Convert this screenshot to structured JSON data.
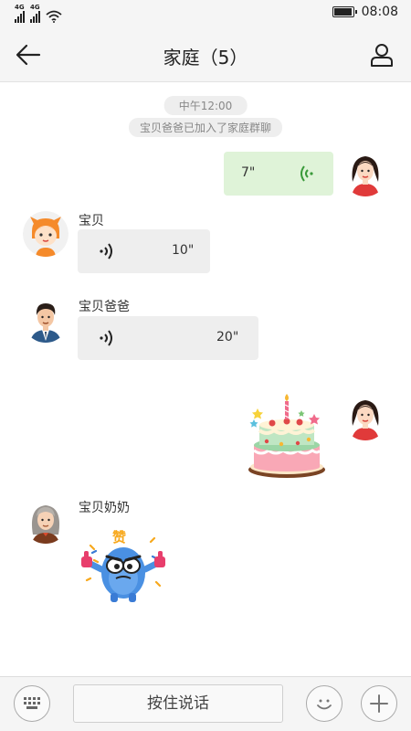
{
  "status_bar": {
    "signal1_label": "4G",
    "signal2_label": "4G",
    "time": "08:08",
    "battery_level": 0.95
  },
  "header": {
    "title": "家庭（5）",
    "back_icon": "arrow-left-icon",
    "members_icon": "user-icon"
  },
  "chat": {
    "time_label": "中午12:00",
    "notice": "宝贝爸爸已加入了家庭群聊",
    "messages": [
      {
        "side": "right",
        "type": "voice",
        "duration": "7\"",
        "avatar": "mom-avatar"
      },
      {
        "side": "left",
        "type": "voice",
        "sender": "宝贝",
        "duration": "10\"",
        "avatar": "baby-avatar"
      },
      {
        "side": "left",
        "type": "voice",
        "sender": "宝贝爸爸",
        "duration": "20\"",
        "avatar": "dad-avatar"
      },
      {
        "side": "right",
        "type": "sticker",
        "sticker": "birthday-cake-sticker",
        "avatar": "mom-avatar"
      },
      {
        "side": "left",
        "type": "sticker",
        "sender": "宝贝奶奶",
        "sticker": "thumbs-up-monster-sticker",
        "sticker_text": "赞",
        "avatar": "grandma-avatar"
      }
    ]
  },
  "input_bar": {
    "hold_to_talk": "按住说话",
    "keyboard_icon": "keyboard-icon",
    "emoji_icon": "smiley-icon",
    "more_icon": "plus-icon"
  },
  "colors": {
    "sent_bubble": "#dff3d8",
    "received_bubble": "#eeeeee",
    "voice_wave_sent": "#3a9a3a"
  }
}
